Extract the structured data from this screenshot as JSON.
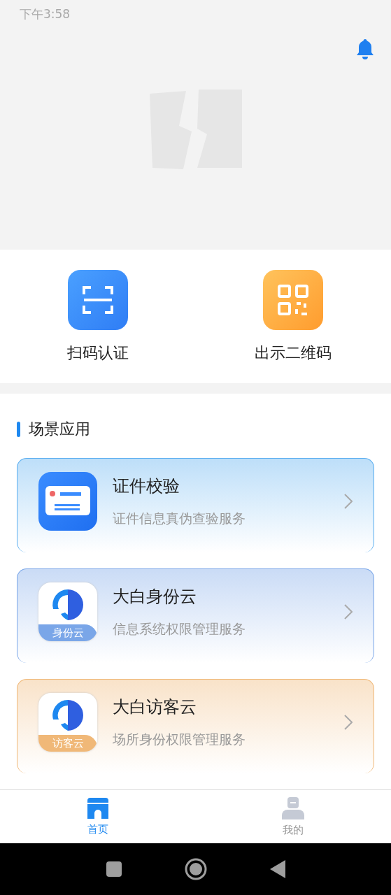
{
  "status_bar": {
    "time": "下午3:58"
  },
  "quick_actions": [
    {
      "kind": "scan",
      "label": "扫码认证"
    },
    {
      "kind": "qrcode",
      "label": "出示二维码"
    }
  ],
  "section": {
    "title": "场景应用"
  },
  "scenes": [
    {
      "kind": "card",
      "title": "证件校验",
      "subtitle": "证件信息真伪查验服务",
      "color": "#5aaef0"
    },
    {
      "kind": "logo",
      "title": "大白身份云",
      "subtitle": "信息系统权限管理服务",
      "badge": "身份云",
      "color": "#7aa6e8"
    },
    {
      "kind": "logo",
      "title": "大白访客云",
      "subtitle": "场所身份权限管理服务",
      "badge": "访客云",
      "color": "#f0b878"
    }
  ],
  "tabs": [
    {
      "kind": "home",
      "label": "首页",
      "selected": true
    },
    {
      "kind": "person",
      "label": "我的",
      "selected": false
    }
  ]
}
